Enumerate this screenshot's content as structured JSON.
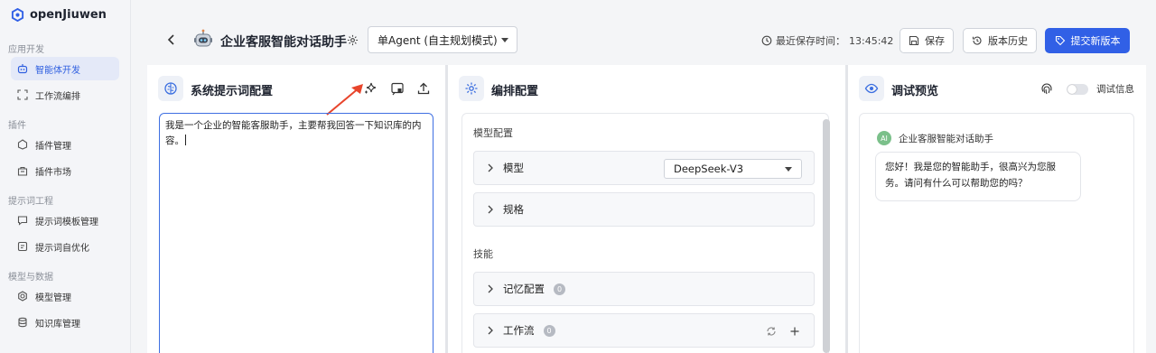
{
  "app": {
    "name": "openJiuwen"
  },
  "sidebar": {
    "sections": [
      {
        "label": "应用开发",
        "items": [
          {
            "label": "智能体开发",
            "icon": "bot-icon",
            "active": true
          },
          {
            "label": "工作流编排",
            "icon": "workflow-icon"
          }
        ]
      },
      {
        "label": "插件",
        "items": [
          {
            "label": "插件管理",
            "icon": "plugin-icon"
          },
          {
            "label": "插件市场",
            "icon": "market-icon"
          }
        ]
      },
      {
        "label": "提示词工程",
        "items": [
          {
            "label": "提示词模板管理",
            "icon": "chat-template-icon"
          },
          {
            "label": "提示词自优化",
            "icon": "optimize-icon"
          }
        ]
      },
      {
        "label": "模型与数据",
        "items": [
          {
            "label": "模型管理",
            "icon": "model-icon"
          },
          {
            "label": "知识库管理",
            "icon": "database-icon"
          }
        ]
      }
    ]
  },
  "header": {
    "title": "企业客服智能对话助手",
    "mode": "单Agent (自主规划模式)",
    "saved_label": "最近保存时间：",
    "saved_time": "13:45:42",
    "save": "保存",
    "history": "版本历史",
    "submit": "提交新版本",
    "accent": "#3160e6"
  },
  "prompt_panel": {
    "title": "系统提示词配置",
    "content": "我是一个企业的智能客服助手，主要帮我回答一下知识库的内容。"
  },
  "config_panel": {
    "title": "编排配置",
    "model_section": "模型配置",
    "model_label": "模型",
    "model_value": "DeepSeek-V3",
    "spec_label": "规格",
    "skills_section": "技能",
    "memory_label": "记忆配置",
    "memory_count": "0",
    "workflow_label": "工作流",
    "workflow_count": "0"
  },
  "debug_panel": {
    "title": "调试预览",
    "debug_info": "调试信息",
    "bot_name": "企业客服智能对话助手",
    "avatar_text": "AI",
    "greeting": "您好！我是您的智能助手，很高兴为您服务。请问有什么可以帮助您的吗？"
  }
}
